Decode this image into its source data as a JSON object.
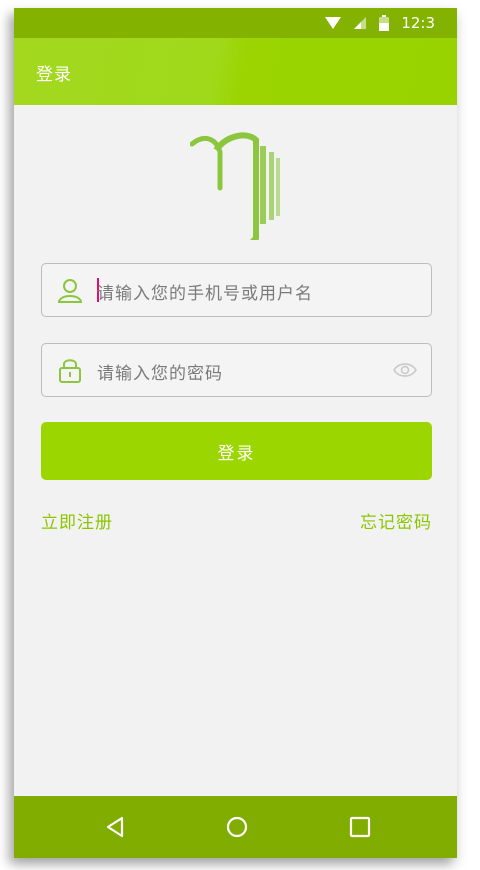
{
  "status": {
    "time": "12:3"
  },
  "appbar": {
    "title": "登录"
  },
  "form": {
    "username_placeholder": "请输入您的手机号或用户名",
    "password_placeholder": "请输入您的密码",
    "login_label": "登录"
  },
  "links": {
    "register": "立即注册",
    "forgot": "忘记密码"
  },
  "colors": {
    "accent": "#9cd600",
    "statusbar": "#83b300",
    "navbar": "#80ad00"
  }
}
